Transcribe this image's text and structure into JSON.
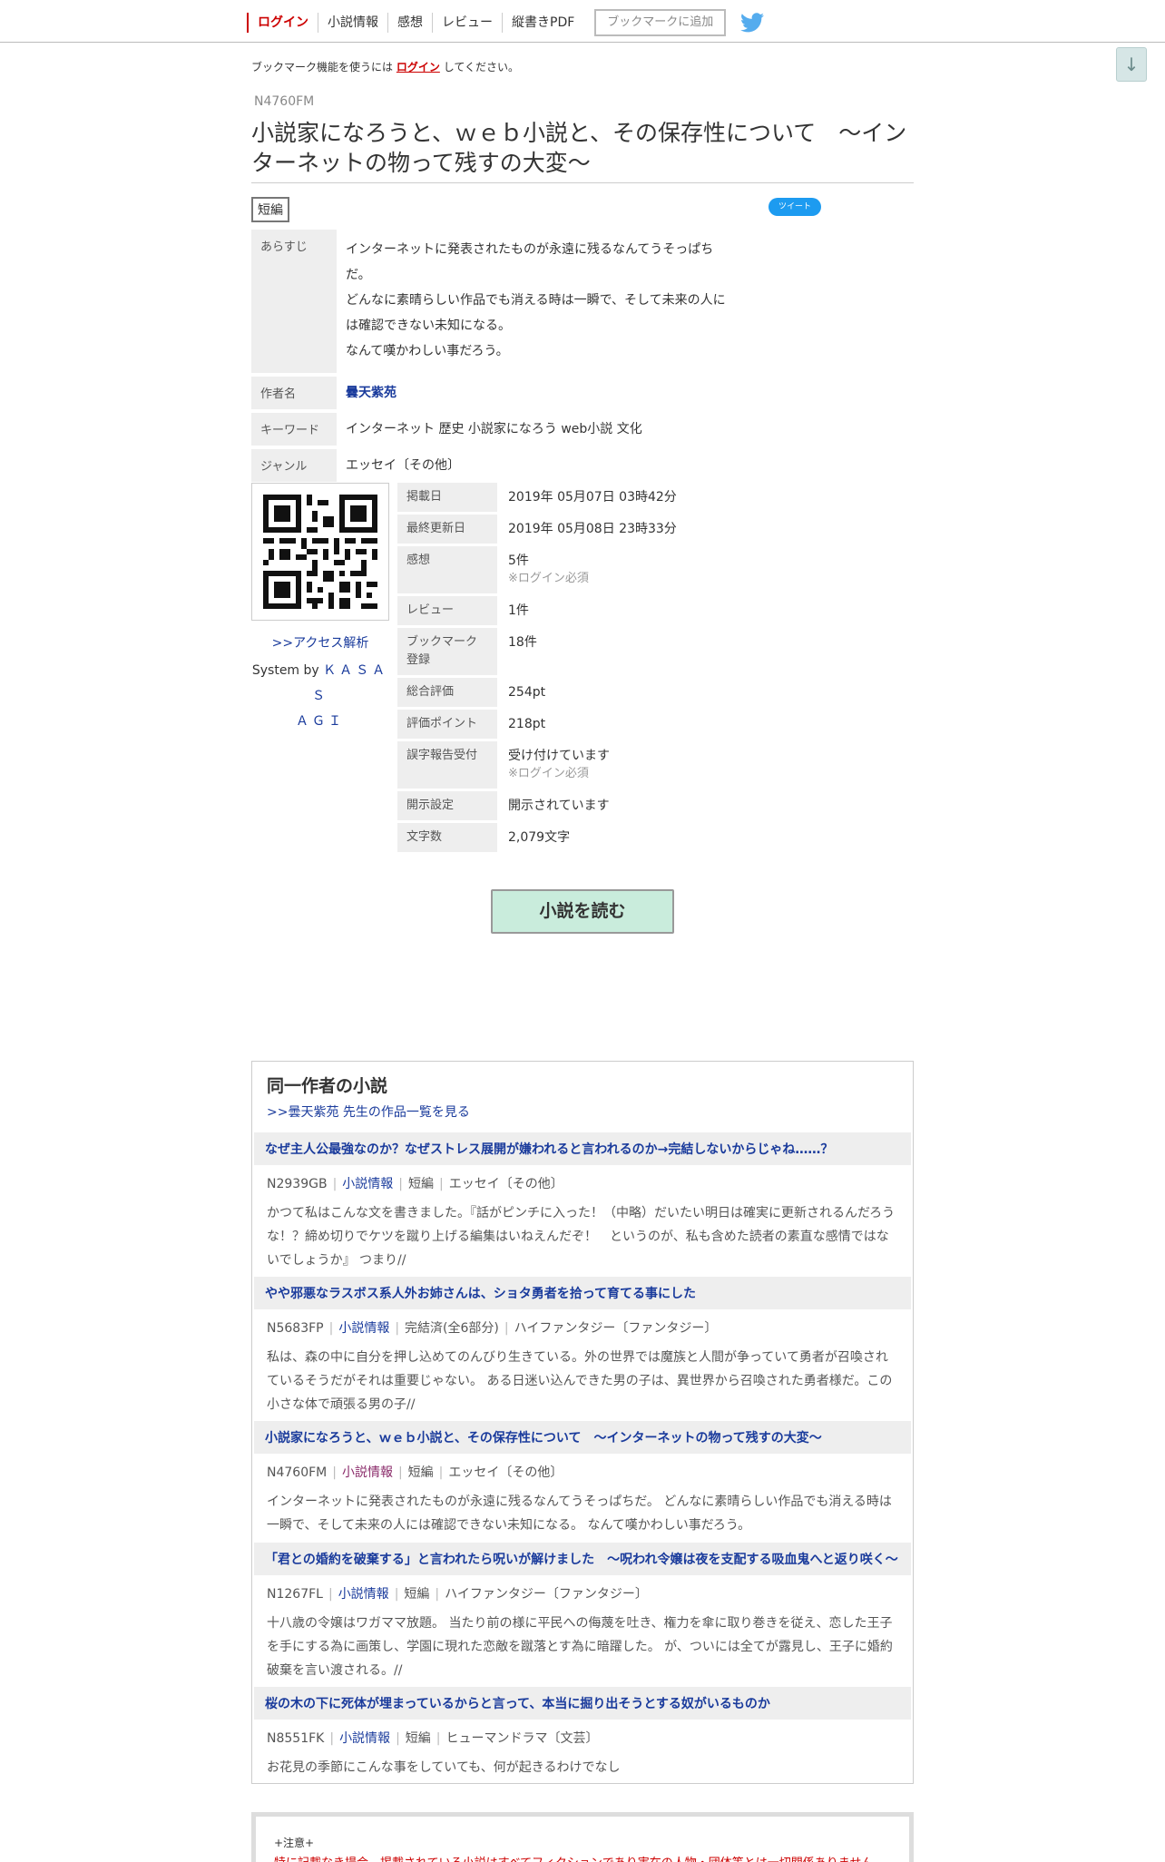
{
  "header": {
    "nav": [
      "ログイン",
      "小説情報",
      "感想",
      "レビュー",
      "縦書きPDF"
    ],
    "bookmark_label": "ブックマークに追加",
    "scroll_down": "↓"
  },
  "notice": {
    "prefix": "ブックマーク機能を使うには",
    "link": "ログイン",
    "suffix": "してください。"
  },
  "novel": {
    "ncode": "N4760FM",
    "title": "小説家になろうと、ｗｅｂ小説と、その保存性について　〜インターネットの物って残すの大変〜",
    "type": "短編",
    "tweet": "ツイート",
    "info": {
      "synopsis_label": "あらすじ",
      "synopsis": [
        "インターネットに発表されたものが永遠に残るなんてうそっぱち",
        "だ。",
        "どんなに素晴らしい作品でも消える時は一瞬で、そして未来の人に",
        "は確認できない未知になる。",
        "なんて嘆かわしい事だろう。"
      ],
      "author_label": "作者名",
      "author": "曇天紫苑",
      "keyword_label": "キーワード",
      "keywords": "インターネット 歴史 小説家になろう web小説 文化",
      "genre_label": "ジャンル",
      "genre": "エッセイ〔その他〕"
    },
    "access_link": ">>アクセス解析",
    "system_by": "System by",
    "kasasagi_1": "ＫＡＳＡＳ",
    "kasasagi_2": "ＡＧＩ",
    "stats": [
      {
        "label": "掲載日",
        "value": "2019年 05月07日 03時42分",
        "note": ""
      },
      {
        "label": "最終更新日",
        "value": "2019年 05月08日 23時33分",
        "note": ""
      },
      {
        "label": "感想",
        "value": "5件",
        "note": "※ログイン必須"
      },
      {
        "label": "レビュー",
        "value": "1件",
        "note": ""
      },
      {
        "label": "ブックマーク登録",
        "value": "18件",
        "note": ""
      },
      {
        "label": "総合評価",
        "value": "254pt",
        "note": ""
      },
      {
        "label": "評価ポイント",
        "value": "218pt",
        "note": ""
      },
      {
        "label": "誤字報告受付",
        "value": "受け付けています",
        "note": "※ログイン必須"
      },
      {
        "label": "開示設定",
        "value": "開示されています",
        "note": ""
      },
      {
        "label": "文字数",
        "value": "2,079文字",
        "note": ""
      }
    ],
    "read_button": "小説を読む"
  },
  "same_author": {
    "heading": "同一作者の小説",
    "list_link": ">>曇天紫苑 先生の作品一覧を見る",
    "items": [
      {
        "title": "なぜ主人公最強なのか？なぜストレス展開が嫌われると言われるのか→完結しないからじゃね……？",
        "ncode": "N2939GB",
        "info": "小説情報",
        "status": "短編",
        "genre": "エッセイ〔その他〕",
        "desc": "かつて私はこんな文を書きました。『話がピンチに入った！（中略）だいたい明日は確実に更新されるんだろうな！？締め切りでケツを蹴り上げる編集はいねえんだぞ！　というのが、私も含めた読者の素直な感情ではないでしょうか』 つまり//"
      },
      {
        "title": "やや邪悪なラスボス系人外お姉さんは、ショタ勇者を拾って育てる事にした",
        "ncode": "N5683FP",
        "info": "小説情報",
        "status": "完結済(全6部分)",
        "genre": "ハイファンタジー〔ファンタジー〕",
        "desc": "私は、森の中に自分を押し込めてのんびり生きている。外の世界では魔族と人間が争っていて勇者が召喚されているそうだがそれは重要じゃない。 ある日迷い込んできた男の子は、異世界から召喚された勇者様だ。この小さな体で頑張る男の子//"
      },
      {
        "title": "小説家になろうと、ｗｅｂ小説と、その保存性について　〜インターネットの物って残すの大変〜",
        "ncode": "N4760FM",
        "info": "小説情報",
        "status": "短編",
        "genre": "エッセイ〔その他〕",
        "desc": "インターネットに発表されたものが永遠に残るなんてうそっぱちだ。 どんなに素晴らしい作品でも消える時は一瞬で、そして未来の人には確認できない未知になる。 なんて嘆かわしい事だろう。"
      },
      {
        "title": "「君との婚約を破棄する」と言われたら呪いが解けました　〜呪われ令嬢は夜を支配する吸血鬼へと返り咲く〜",
        "ncode": "N1267FL",
        "info": "小説情報",
        "status": "短編",
        "genre": "ハイファンタジー〔ファンタジー〕",
        "desc": "十八歳の令嬢はワガママ放題。 当たり前の様に平民への侮蔑を吐き、権力を傘に取り巻きを従え、恋した王子を手にする為に画策し、学園に現れた恋敵を蹴落とす為に暗躍した。 が、ついには全てが露見し、王子に婚約破棄を言い渡される。//"
      },
      {
        "title": "桜の木の下に死体が埋まっているからと言って、本当に掘り出そうとする奴がいるものか",
        "ncode": "N8551FK",
        "info": "小説情報",
        "status": "短編",
        "genre": "ヒューマンドラマ〔文芸〕",
        "desc": "お花見の季節にこんな事をしていても、何が起きるわけでなし"
      }
    ]
  },
  "caution": {
    "head": "+注意+",
    "body": "特に記載なき場合、掲載されている小説はすべてフィクションであり実在の人物・団体等とは一切関係ありません。"
  },
  "colors": {
    "accent_red": "#cc0000",
    "link_blue": "#1a3b9c",
    "read_button_bg": "#c9ecdc",
    "twitter": "#1d9bf0"
  }
}
